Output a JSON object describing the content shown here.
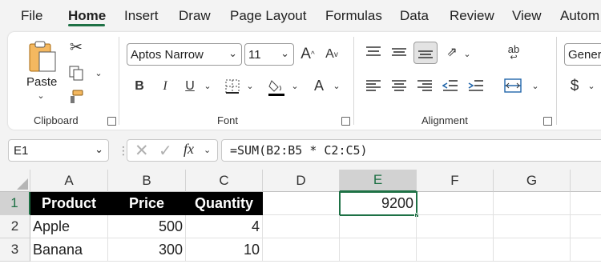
{
  "menu": {
    "tabs": [
      "File",
      "Home",
      "Insert",
      "Draw",
      "Page Layout",
      "Formulas",
      "Data",
      "Review",
      "View",
      "Autom"
    ],
    "active": "Home"
  },
  "ribbon": {
    "clipboard": {
      "paste_label": "Paste",
      "group_label": "Clipboard"
    },
    "font": {
      "font_name": "Aptos Narrow",
      "font_size": "11",
      "group_label": "Font",
      "bold": "B",
      "italic": "I",
      "underline": "U",
      "grow": "A",
      "shrink": "A",
      "font_color": "A"
    },
    "alignment": {
      "group_label": "Alignment",
      "wrap_glyph": "ab"
    },
    "number": {
      "format": "Genera",
      "currency": "$"
    }
  },
  "formula_bar": {
    "name_box": "E1",
    "fx": "fx",
    "formula": "=SUM(B2:B5 * C2:C5)"
  },
  "sheet": {
    "columns": [
      "A",
      "B",
      "C",
      "D",
      "E",
      "F",
      "G"
    ],
    "selected_column": "E",
    "rows": [
      {
        "num": "1",
        "cells": [
          "Product",
          "Price",
          "Quantity",
          "",
          "9200",
          "",
          ""
        ]
      },
      {
        "num": "2",
        "cells": [
          "Apple",
          "500",
          "4",
          "",
          "",
          "",
          ""
        ]
      },
      {
        "num": "3",
        "cells": [
          "Banana",
          "300",
          "10",
          "",
          "",
          "",
          ""
        ]
      }
    ]
  },
  "colors": {
    "accent": "#1e7145",
    "header_fill": "#000000",
    "header_text": "#ffffff"
  }
}
